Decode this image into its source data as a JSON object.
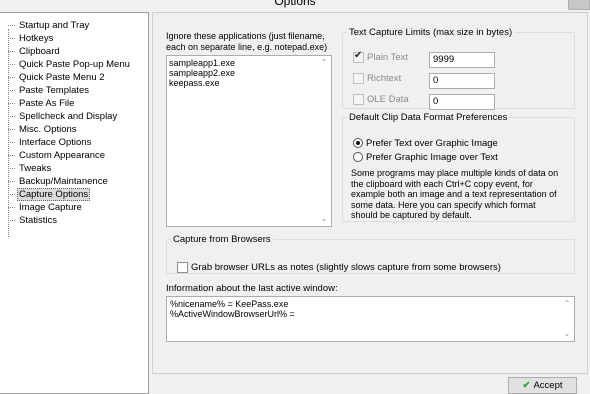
{
  "window": {
    "title": "Options"
  },
  "nav": {
    "items": [
      {
        "label": "Startup and Tray"
      },
      {
        "label": "Hotkeys"
      },
      {
        "label": "Clipboard"
      },
      {
        "label": "Quick Paste Pop-up Menu"
      },
      {
        "label": "Quick Paste Menu 2"
      },
      {
        "label": "Paste Templates"
      },
      {
        "label": "Paste As File"
      },
      {
        "label": "Spellcheck and Display"
      },
      {
        "label": "Misc. Options"
      },
      {
        "label": "Interface Options"
      },
      {
        "label": "Custom Appearance"
      },
      {
        "label": "Tweaks"
      },
      {
        "label": "Backup/Maintanence"
      },
      {
        "label": "Capture Options"
      },
      {
        "label": "Image Capture"
      },
      {
        "label": "Statistics"
      }
    ],
    "selected": "Capture Options"
  },
  "ignore": {
    "label": "Ignore these applications (just filename, each on separate line, e.g. notepad.exe)",
    "lines": [
      "sampleapp1.exe",
      "sampleapp2.exe",
      "keepass.exe"
    ]
  },
  "text_capture_limits": {
    "legend": "Text Capture Limits (max size in bytes)",
    "plain_text": {
      "label": "Plain Text",
      "value": "9999",
      "checked": true
    },
    "richtext": {
      "label": "Richtext",
      "value": "0",
      "checked": false
    },
    "ole_data": {
      "label": "OLE Data",
      "value": "0",
      "checked": false
    }
  },
  "default_format": {
    "legend": "Default Clip Data Format Preferences",
    "option_text": "Prefer Text over Graphic Image",
    "option_image": "Prefer Graphic Image over Text",
    "selected": "text",
    "description": "Some programs may place multiple kinds of data on the clipboard with each Ctrl+C copy event, for example both an image and a text representation of some data.  Here you can specify which format should be captured by default."
  },
  "browsers": {
    "legend": "Capture from Browsers",
    "grab_urls_label": "Grab browser URLs as notes (slightly slows capture from some browsers)",
    "grab_urls_checked": false
  },
  "last_window": {
    "label": "Information about the last active window:",
    "lines": [
      "%nicename% = KeePass.exe",
      "%ActiveWindowBrowserUrl% ="
    ]
  },
  "buttons": {
    "accept": "Accept"
  }
}
